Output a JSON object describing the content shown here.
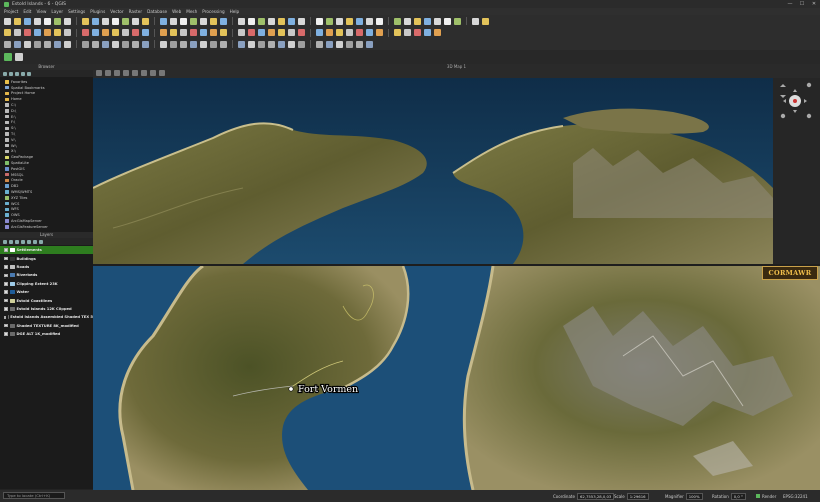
{
  "window": {
    "title": "Estold Islands - 6 - QGIS",
    "controls": [
      "—",
      "☐",
      "✕"
    ]
  },
  "menu": [
    "Project",
    "Edit",
    "View",
    "Layer",
    "Settings",
    "Plugins",
    "Vector",
    "Raster",
    "Database",
    "Web",
    "Mesh",
    "Processing",
    "Help"
  ],
  "browser": {
    "title": "Browser",
    "items": [
      {
        "label": "Favorites",
        "icon": "star-icon",
        "color": "#e8c04a"
      },
      {
        "label": "Spatial Bookmarks",
        "icon": "bookmark-icon",
        "color": "#7fa6d6"
      },
      {
        "label": "Project Home",
        "icon": "folder-icon",
        "color": "#e6b84a"
      },
      {
        "label": "Home",
        "icon": "folder-icon",
        "color": "#e6b84a"
      },
      {
        "label": "C:\\",
        "icon": "drive-icon",
        "color": "#bbbbbb"
      },
      {
        "label": "D:\\",
        "icon": "drive-icon",
        "color": "#bbbbbb"
      },
      {
        "label": "E:\\",
        "icon": "drive-icon",
        "color": "#bbbbbb"
      },
      {
        "label": "F:\\",
        "icon": "drive-icon",
        "color": "#bbbbbb"
      },
      {
        "label": "S:\\",
        "icon": "drive-icon",
        "color": "#bbbbbb"
      },
      {
        "label": "T:\\",
        "icon": "drive-icon",
        "color": "#bbbbbb"
      },
      {
        "label": "V:\\",
        "icon": "drive-icon",
        "color": "#bbbbbb"
      },
      {
        "label": "W:\\",
        "icon": "drive-icon",
        "color": "#bbbbbb"
      },
      {
        "label": "X:\\",
        "icon": "drive-icon",
        "color": "#bbbbbb"
      },
      {
        "label": "GeoPackage",
        "icon": "geopackage-icon",
        "color": "#d9d96a"
      },
      {
        "label": "SpatiaLite",
        "icon": "spatialite-icon",
        "color": "#7fbf6a"
      },
      {
        "label": "PostGIS",
        "icon": "postgis-icon",
        "color": "#6a8fcf"
      },
      {
        "label": "MSSQL",
        "icon": "mssql-icon",
        "color": "#c86a6a"
      },
      {
        "label": "Oracle",
        "icon": "oracle-icon",
        "color": "#d08a4a"
      },
      {
        "label": "DB2",
        "icon": "db2-icon",
        "color": "#6aa0d0"
      },
      {
        "label": "WMS/WMTS",
        "icon": "globe-icon",
        "color": "#6ab0d0"
      },
      {
        "label": "XYZ Tiles",
        "icon": "tiles-icon",
        "color": "#9ac06a"
      },
      {
        "label": "WCS",
        "icon": "globe-icon",
        "color": "#6ab0d0"
      },
      {
        "label": "WFS",
        "icon": "globe-icon",
        "color": "#6ab0d0"
      },
      {
        "label": "OWS",
        "icon": "globe-icon",
        "color": "#6ab0d0"
      },
      {
        "label": "ArcGisMapServer",
        "icon": "arcgis-icon",
        "color": "#8a8ad0"
      },
      {
        "label": "ArcGisFeatureServer",
        "icon": "arcgis-icon",
        "color": "#8a8ad0"
      }
    ]
  },
  "layers": {
    "title": "Layers",
    "items": [
      {
        "label": "Settlements",
        "symbol": "#ffffff",
        "selected": true
      },
      {
        "label": "Buildings",
        "symbol": "#333333",
        "selected": false
      },
      {
        "label": "Roads",
        "symbol": "#c0c0c0",
        "selected": false
      },
      {
        "label": "Riverbeds",
        "symbol": "#4a7ab0",
        "selected": false
      },
      {
        "label": "Clipping Extent 23K",
        "symbol": "#9ecbe8",
        "selected": false
      },
      {
        "label": "Water",
        "symbol": "#1f5d99",
        "selected": false
      },
      {
        "label": "Estold Coastlines",
        "symbol": "#cfcf9a",
        "selected": false
      },
      {
        "label": "Estold Islands 12K Clipped",
        "symbol": "#6a6a6a",
        "selected": false
      },
      {
        "label": "Estold Islands Assembled Shaded TEX 5",
        "symbol": "#6a6a6a",
        "selected": false
      },
      {
        "label": "Shaded TEXTURE 8K_modified",
        "symbol": "#6a6a6a",
        "selected": false
      },
      {
        "label": "DGE ALT 1K_modified",
        "symbol": "#6a6a6a",
        "selected": false
      }
    ]
  },
  "map3d": {
    "title": "3D Map 1"
  },
  "map2d": {
    "town_label": "Fort Vormen",
    "logo_text": "CORMAWR"
  },
  "colors": {
    "water": "#1c4f78",
    "land": "#6b6a3a",
    "accent": "#2e7d1f"
  },
  "status": {
    "search_placeholder": "Type to locate (Ctrl+K)",
    "coordinate_label": "Coordinate",
    "coordinate_value": "62,7553,28,0,03",
    "scale_label": "Scale",
    "scale_value": "1:29616",
    "magnifier_label": "Magnifier",
    "magnifier_value": "100%",
    "rotation_label": "Rotation",
    "rotation_value": "0,0 °",
    "render_label": "Render",
    "crs_label": "EPSG:32241"
  }
}
